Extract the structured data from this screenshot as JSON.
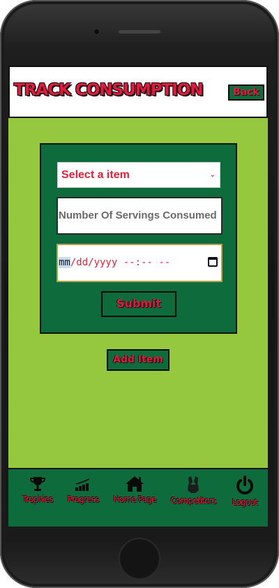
{
  "header": {
    "title": "TRACK CONSUMPTION",
    "back_label": "Back"
  },
  "form": {
    "select_value": "Select a item",
    "servings_placeholder": "Number Of Servings Consumed",
    "date_mm": "mm",
    "date_rest": "/dd/yyyy --:-- --",
    "submit_label": "Submit"
  },
  "add_item_label": "Add Item",
  "nav": {
    "items": [
      {
        "label": "Trophies",
        "icon": "trophy-icon"
      },
      {
        "label": "Progress",
        "icon": "bar-chart-icon"
      },
      {
        "label": "Home Page",
        "icon": "home-icon"
      },
      {
        "label": "Competitors",
        "icon": "high-five-icon"
      },
      {
        "label": "Logout",
        "icon": "power-icon"
      }
    ]
  },
  "colors": {
    "background": "#95c83f",
    "panel": "#0d6b3c",
    "accent_text": "#e8173e"
  }
}
